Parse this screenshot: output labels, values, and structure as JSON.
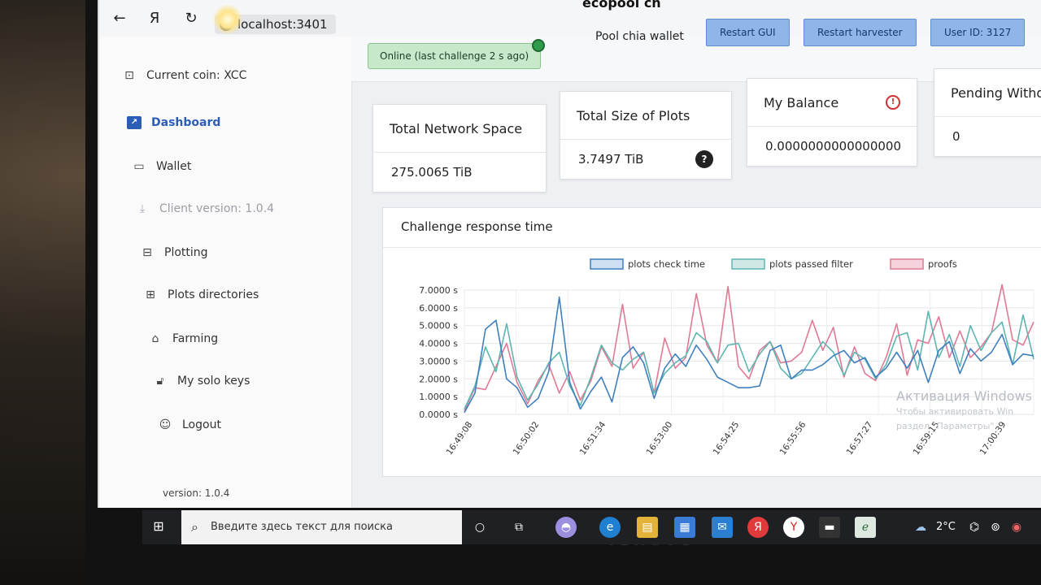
{
  "browser": {
    "url": "localhost:3401",
    "title": "ecopool ch"
  },
  "sidebar": {
    "items": [
      {
        "label": "Current coin: XCC",
        "icon": "coin-icon"
      },
      {
        "label": "Dashboard",
        "icon": "chart-icon"
      },
      {
        "label": "Wallet",
        "icon": "wallet-icon"
      },
      {
        "label": "Client version: 1.0.4",
        "icon": "download-icon"
      },
      {
        "label": "Plotting",
        "icon": "drive-icon"
      },
      {
        "label": "Plots directories",
        "icon": "folder-plus-icon"
      },
      {
        "label": "Farming",
        "icon": "farm-icon"
      },
      {
        "label": "My solo keys",
        "icon": "lock-icon"
      },
      {
        "label": "Logout",
        "icon": "user-icon"
      }
    ],
    "version": "version: 1.0.4"
  },
  "header": {
    "status": "Online (last challenge 2 s ago)",
    "pool_label": "Pool chia wallet",
    "restart_gui": "Restart GUI",
    "restart_harvester": "Restart harvester",
    "user_id": "User ID: 3127"
  },
  "cards": [
    {
      "title": "Total Network Space",
      "value": "275.0065 TiB"
    },
    {
      "title": "Total Size of Plots",
      "value": "3.7497 TiB"
    },
    {
      "title": "My Balance",
      "value": "0.0000000000000000"
    },
    {
      "title": "Pending Withdr",
      "value": "0"
    }
  ],
  "chart_panel_title": "Challenge response time",
  "chart_data": {
    "type": "line",
    "title": "Challenge response time",
    "ylim": [
      0,
      7
    ],
    "y_ticks": [
      "0.0000 s",
      "1.0000 s",
      "2.0000 s",
      "3.0000 s",
      "4.0000 s",
      "5.0000 s",
      "6.0000 s",
      "7.0000 s"
    ],
    "x_ticks": [
      "16:49:08",
      "16:50:02",
      "16:51:34",
      "16:53:00",
      "16:54:25",
      "16:55:56",
      "16:57:27",
      "16:59:15",
      "17:00:39"
    ],
    "legend": [
      "plots check time",
      "plots passed filter",
      "proofs"
    ],
    "colors": {
      "check": "#3f7fbf",
      "passed": "#5fb5b0",
      "proofs": "#e07a94"
    },
    "series": [
      {
        "name": "plots check time",
        "values": [
          0.1,
          1.2,
          4.8,
          5.3,
          2.0,
          1.5,
          0.4,
          0.9,
          2.4,
          6.6,
          1.8,
          0.3,
          1.3,
          2.1,
          0.7,
          3.2,
          3.8,
          2.9,
          0.9,
          2.6,
          3.4,
          2.7,
          3.9,
          3.1,
          2.1,
          1.8,
          1.5,
          1.5,
          1.6,
          3.6,
          3.9,
          2.0,
          2.5,
          2.5,
          2.8,
          3.3,
          3.6,
          2.9,
          3.2,
          2.1,
          2.6,
          3.5,
          2.6,
          3.6,
          1.8,
          3.6,
          4.1,
          2.3,
          3.7,
          3.0,
          3.5,
          4.5,
          2.8,
          3.4,
          3.3
        ]
      },
      {
        "name": "plots passed filter",
        "values": [
          0.3,
          1.6,
          3.8,
          2.4,
          5.1,
          2.1,
          0.8,
          1.7,
          2.9,
          3.5,
          1.6,
          0.5,
          2.1,
          3.9,
          2.9,
          2.5,
          3.1,
          3.5,
          1.2,
          2.3,
          2.9,
          3.3,
          4.6,
          4.1,
          2.9,
          3.9,
          4.0,
          2.4,
          3.4,
          4.1,
          2.6,
          2.0,
          2.3,
          3.2,
          4.1,
          3.5,
          2.2,
          3.5,
          3.1,
          2.0,
          2.8,
          4.4,
          4.6,
          2.5,
          5.8,
          3.2,
          4.5,
          2.7,
          5.0,
          3.6,
          4.6,
          5.2,
          2.8,
          5.6,
          3.1
        ]
      },
      {
        "name": "proofs",
        "values": [
          0.2,
          1.5,
          1.4,
          2.7,
          4.0,
          1.8,
          0.6,
          1.9,
          2.8,
          1.2,
          2.4,
          0.8,
          1.9,
          3.8,
          2.7,
          6.2,
          2.6,
          3.5,
          1.2,
          4.3,
          2.6,
          3.2,
          6.8,
          3.9,
          2.9,
          7.2,
          2.7,
          2.0,
          3.6,
          4.1,
          2.9,
          3.0,
          3.5,
          5.3,
          3.6,
          4.9,
          2.1,
          3.8,
          2.3,
          1.9,
          3.2,
          5.1,
          2.2,
          4.2,
          4.0,
          5.5,
          3.2,
          4.7,
          3.2,
          3.8,
          4.6,
          7.3,
          4.2,
          3.9,
          5.2
        ]
      }
    ]
  },
  "watermark": {
    "line1": "Активация Windows",
    "line2": "Чтобы активировать Win",
    "line3": "раздел \"Параметры\""
  },
  "taskbar": {
    "search_placeholder": "Введите здесь текст для поиска",
    "temperature": "2°C"
  }
}
